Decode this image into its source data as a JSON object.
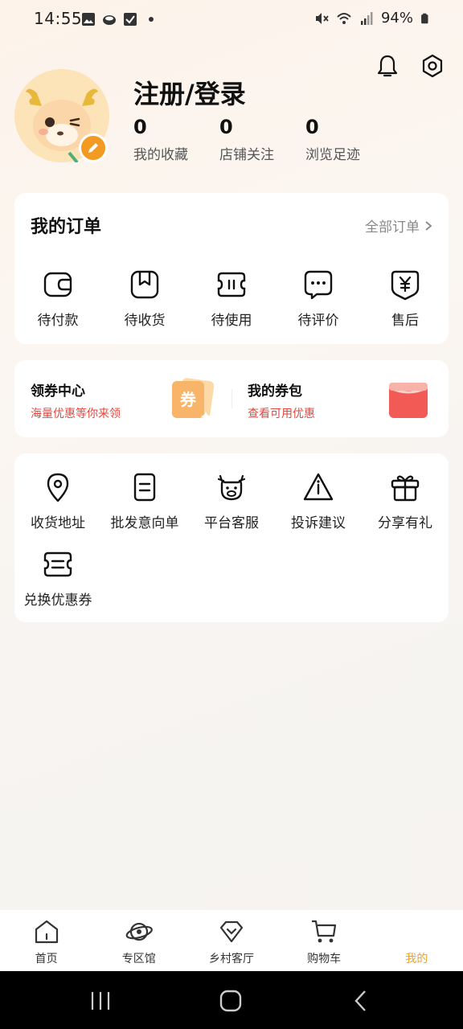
{
  "status": {
    "time": "14:55",
    "battery": "94%"
  },
  "profile": {
    "login_text": "注册/登录",
    "stats": [
      {
        "value": "0",
        "label": "我的收藏"
      },
      {
        "value": "0",
        "label": "店铺关注"
      },
      {
        "value": "0",
        "label": "浏览足迹"
      }
    ]
  },
  "orders": {
    "title": "我的订单",
    "all_label": "全部订单",
    "items": [
      {
        "label": "待付款",
        "icon": "wallet-icon"
      },
      {
        "label": "待收货",
        "icon": "package-icon"
      },
      {
        "label": "待使用",
        "icon": "ticket-icon"
      },
      {
        "label": "待评价",
        "icon": "comment-icon"
      },
      {
        "label": "售后",
        "icon": "after-sales-icon"
      }
    ]
  },
  "coupons": {
    "center": {
      "title": "领券中心",
      "subtitle": "海量优惠等你来领",
      "badge": "券"
    },
    "wallet": {
      "title": "我的券包",
      "subtitle": "查看可用优惠"
    }
  },
  "services": {
    "items": [
      {
        "label": "收货地址",
        "icon": "location-pin-icon"
      },
      {
        "label": "批发意向单",
        "icon": "document-icon"
      },
      {
        "label": "平台客服",
        "icon": "deer-service-icon"
      },
      {
        "label": "投诉建议",
        "icon": "warning-icon"
      },
      {
        "label": "分享有礼",
        "icon": "gift-icon"
      },
      {
        "label": "兑换优惠券",
        "icon": "coupon-exchange-icon"
      }
    ]
  },
  "tabbar": {
    "items": [
      {
        "label": "首页",
        "icon": "home-icon"
      },
      {
        "label": "专区馆",
        "icon": "planet-icon"
      },
      {
        "label": "乡村客厅",
        "icon": "diamond-icon"
      },
      {
        "label": "购物车",
        "icon": "cart-icon"
      },
      {
        "label": "我的",
        "icon": "profile-icon"
      }
    ],
    "active": "我的",
    "active_color": "#f0a020"
  },
  "colors": {
    "accent_red": "#e8453c",
    "accent_orange": "#f39a22"
  }
}
